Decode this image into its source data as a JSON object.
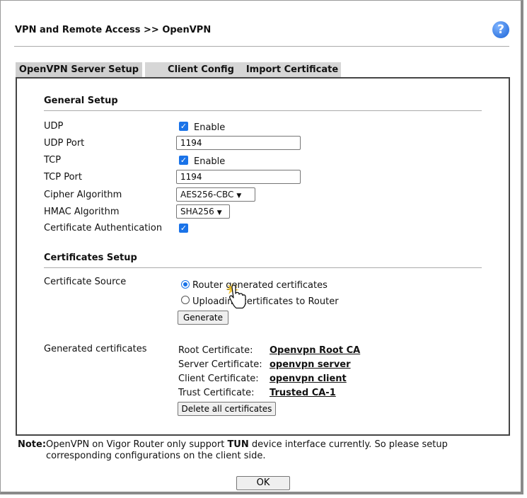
{
  "header": {
    "title": "VPN and Remote Access >> OpenVPN",
    "help_icon": "question-icon"
  },
  "tabs": [
    {
      "label": "OpenVPN Server Setup",
      "active": true
    },
    {
      "label": "Client Config",
      "active": false
    },
    {
      "label": "Import Certificate",
      "active": false
    }
  ],
  "general": {
    "title": "General Setup",
    "udp": {
      "label": "UDP",
      "checked": true,
      "check_label": "Enable"
    },
    "udp_port": {
      "label": "UDP Port",
      "value": "1194"
    },
    "tcp": {
      "label": "TCP",
      "checked": true,
      "check_label": "Enable"
    },
    "tcp_port": {
      "label": "TCP Port",
      "value": "1194"
    },
    "cipher": {
      "label": "Cipher Algorithm",
      "value": "AES256-CBC"
    },
    "hmac": {
      "label": "HMAC Algorithm",
      "value": "SHA256"
    },
    "cert_auth": {
      "label": "Certificate Authentication",
      "checked": true
    }
  },
  "certs_setup": {
    "title": "Certificates Setup",
    "source_label": "Certificate Source",
    "option_router": "Router generated certificates",
    "option_upload": "Uploading certificates to Router",
    "generate_label": "Generate",
    "generated_label": "Generated certificates",
    "root_label": "Root Certificate:",
    "root_value": "Openvpn Root CA",
    "server_label": "Server Certificate:",
    "server_value": "openvpn server",
    "client_label": "Client Certificate:",
    "client_value": "openvpn client",
    "trust_label": "Trust Certificate:",
    "trust_value": "Trusted CA-1",
    "delete_label": "Delete all certificates"
  },
  "note": {
    "label": "Note:",
    "line1_pre": "OpenVPN on Vigor Router only support ",
    "line1_bold": "TUN",
    "line1_post": " device interface currently. So please setup",
    "line2": "corresponding configurations on the client side."
  },
  "ok_label": "OK",
  "colors": {
    "accent": "#1a73e8",
    "panel_border": "#444444",
    "tab_bg": "#d6d6d6"
  }
}
